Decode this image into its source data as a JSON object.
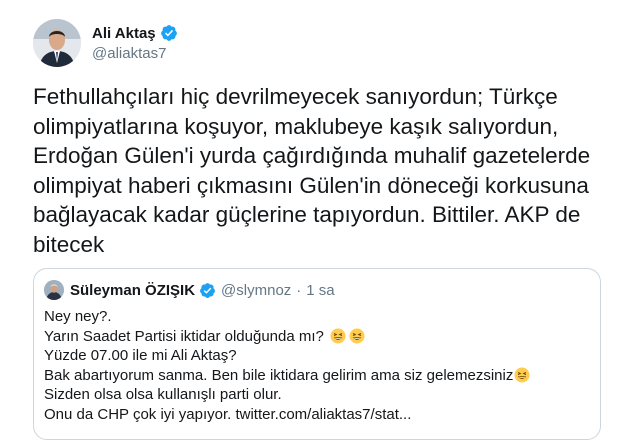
{
  "tweet": {
    "author": {
      "display_name": "Ali Aktaş",
      "handle": "@aliaktas7",
      "verified": true,
      "verified_icon": "verified-badge-icon"
    },
    "text": "Fethullahçıları hiç devrilmeyecek sanıyordun; Türkçe\nolimpiyatlarına koşuyor, maklubeye kaşık salıyordun,\nErdoğan Gülen'i yurda çağırdığında muhalif gazetelerde\nolimpiyat haberi çıkmasını Gülen'in döneceği korkusuna\nbağlayacak kadar güçlerine tapıyordun. Bittiler. AKP de\nbitecek"
  },
  "quoted_tweet": {
    "author": {
      "display_name": "Süleyman ÖZIŞIK",
      "handle": "@slymnoz",
      "verified": true
    },
    "separator": "·",
    "time": "1 sa",
    "lines": [
      {
        "text": "Ney ney?.",
        "emoji": ""
      },
      {
        "text": "Yarın Saadet Partisi iktidar olduğunda mı?",
        "emoji": "😄😄"
      },
      {
        "text": "Yüzde 07.00 ile mi Ali Aktaş?",
        "emoji": ""
      },
      {
        "text": "Bak abartıyorum sanma. Ben bile iktidara gelirim ama siz gelemezsiniz",
        "emoji": "😄"
      },
      {
        "text": "Sizden olsa olsa kullanışlı parti olur.",
        "emoji": ""
      },
      {
        "text": "Onu da CHP çok iyi yapıyor. twitter.com/aliaktas7/stat...",
        "emoji": ""
      }
    ]
  },
  "colors": {
    "text": "#14171a",
    "secondary": "#657786",
    "verified": "#1da1f2",
    "border": "#ccd6dd",
    "emoji": "#ffcc4d"
  }
}
